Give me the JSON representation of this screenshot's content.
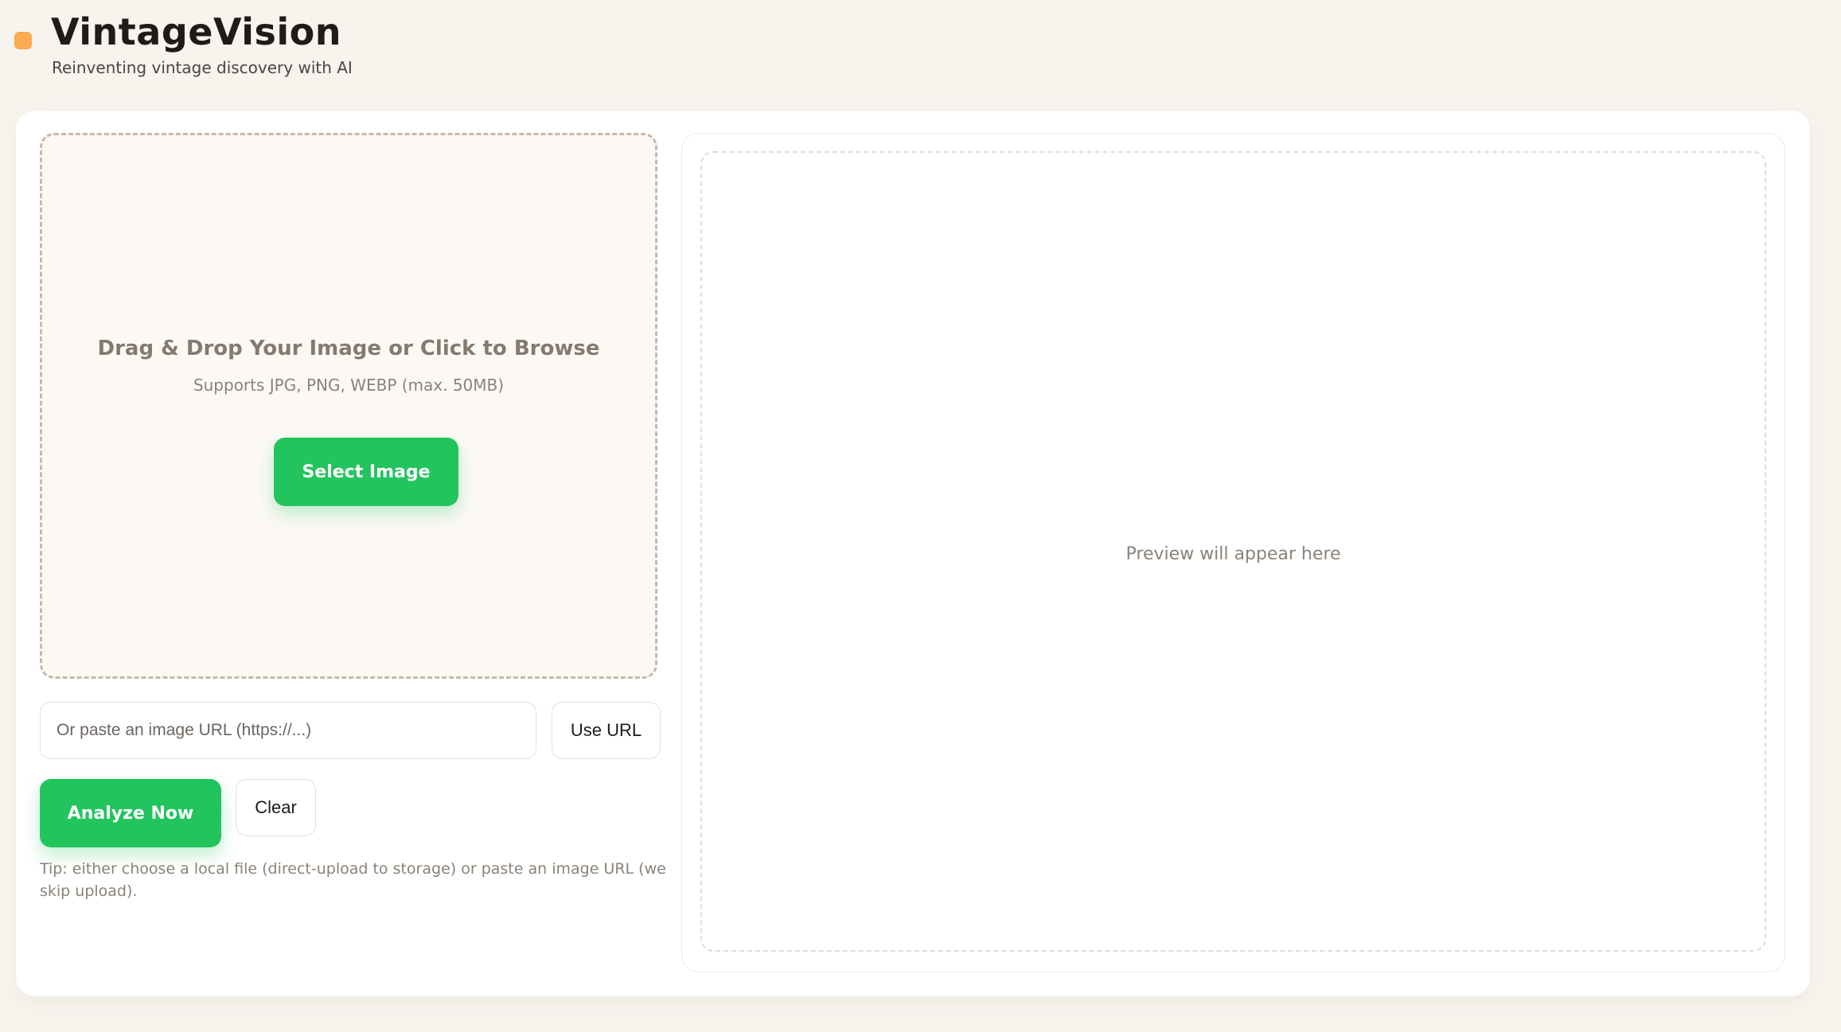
{
  "header": {
    "title": "VintageVision",
    "subtitle": "Reinventing vintage discovery with AI"
  },
  "upload": {
    "dropzone_title": "Drag & Drop Your Image or Click to Browse",
    "dropzone_subtitle": "Supports JPG, PNG, WEBP (max. 50MB)",
    "select_label": "Select Image",
    "url_placeholder": "Or paste an image URL (https://...)",
    "use_url_label": "Use URL",
    "analyze_label": "Analyze Now",
    "clear_label": "Clear",
    "tip": "Tip: either choose a local file (direct-upload to storage) or paste an image URL (we skip upload)."
  },
  "preview": {
    "placeholder": "Preview will appear here"
  },
  "colors": {
    "accent": "#22c45e",
    "brand_dot": "#fbab52",
    "background": "#f7f4ee"
  }
}
